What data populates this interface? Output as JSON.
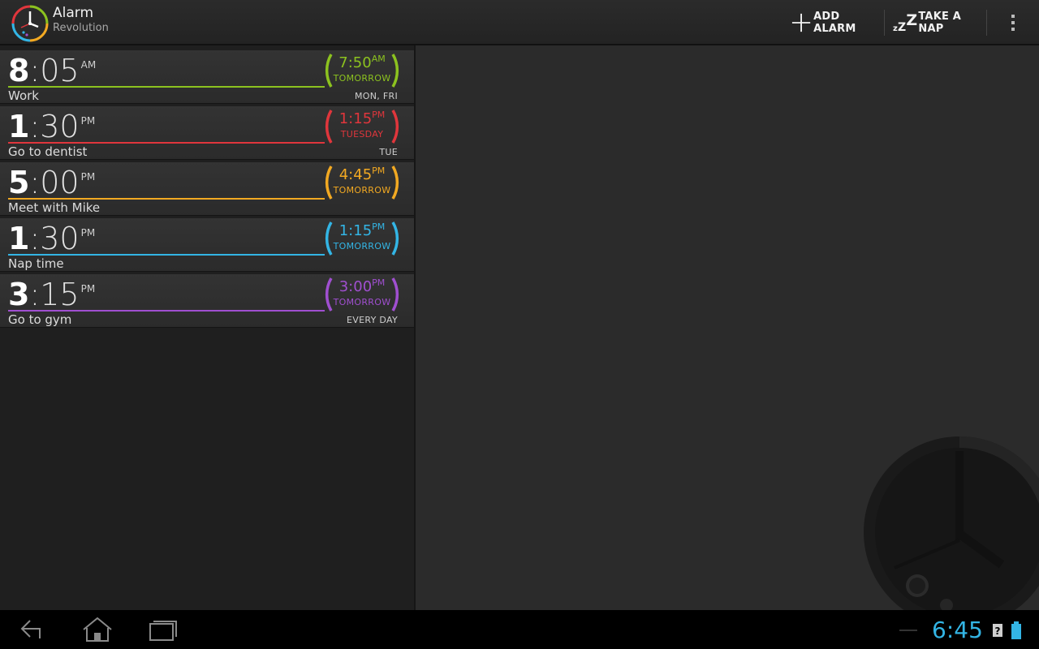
{
  "app": {
    "title": "Alarm",
    "subtitle": "Revolution"
  },
  "actions": {
    "add_alarm": "ADD ALARM",
    "take_a_nap": "TAKE A NAP",
    "nap_icon_text": "zZZ"
  },
  "alarms": [
    {
      "hour": "8",
      "minutes": ":05",
      "ampm": "AM",
      "label": "Work",
      "days": "MON, FRI",
      "ring_time": "7:50",
      "ring_ampm": "AM",
      "ring_day": "TOMORROW",
      "color": "#8cc21f"
    },
    {
      "hour": "1",
      "minutes": ":30",
      "ampm": "PM",
      "label": "Go to dentist",
      "days": "TUE",
      "ring_time": "1:15",
      "ring_ampm": "PM",
      "ring_day": "TUESDAY",
      "color": "#e0363c"
    },
    {
      "hour": "5",
      "minutes": ":00",
      "ampm": "PM",
      "label": "Meet with Mike",
      "days": "",
      "ring_time": "4:45",
      "ring_ampm": "PM",
      "ring_day": "TOMORROW",
      "color": "#f2a922"
    },
    {
      "hour": "1",
      "minutes": ":30",
      "ampm": "PM",
      "label": "Nap time",
      "days": "",
      "ring_time": "1:15",
      "ring_ampm": "PM",
      "ring_day": "TOMORROW",
      "color": "#33b5e5"
    },
    {
      "hour": "3",
      "minutes": ":15",
      "ampm": "PM",
      "label": "Go to gym",
      "days": "EVERY DAY",
      "ring_time": "3:00",
      "ring_ampm": "PM",
      "ring_day": "TOMORROW",
      "color": "#a04fd0"
    }
  ],
  "status_bar": {
    "time": "6:45",
    "accent": "#33b5e5"
  },
  "icons": [
    "alarm-clock-logo-icon",
    "plus-icon",
    "zzz-icon",
    "overflow-menu-icon",
    "back-icon",
    "home-icon",
    "recent-apps-icon",
    "notification-icon",
    "battery-icon",
    "analog-clock-icon"
  ]
}
